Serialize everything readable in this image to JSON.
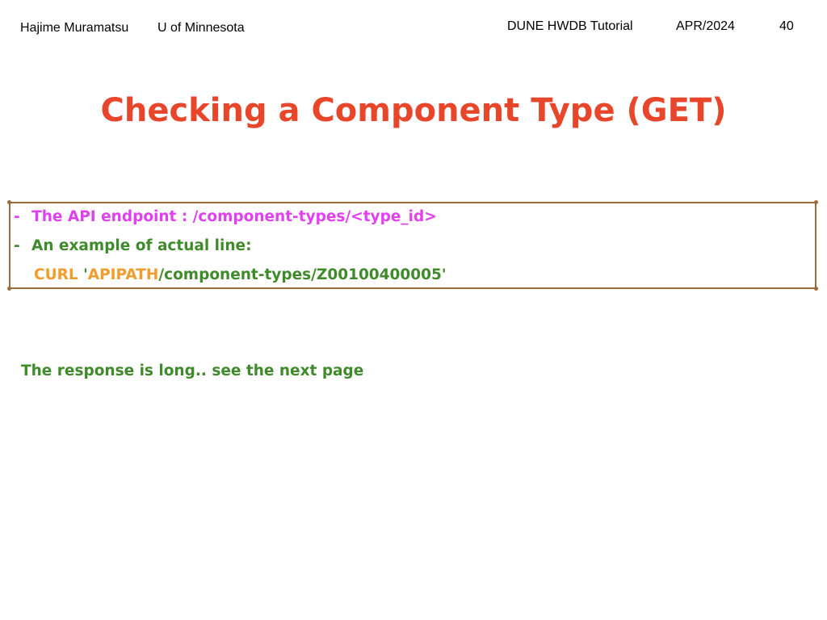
{
  "header": {
    "author": "Hajime Muramatsu",
    "institution": "U of Minnesota",
    "talk": "DUNE HWDB Tutorial",
    "date": "APR/2024",
    "page_number": "40"
  },
  "title": "Checking a Component Type (GET)",
  "box": {
    "line1_bullet": "-",
    "line1_text": "The API endpoint : /component-types/<type_id>",
    "line2_bullet": "-",
    "line2_text": "An example of actual line:",
    "line3_curl": "CURL",
    "line3_quote_open": "'",
    "line3_apipath": "APIPATH",
    "line3_rest": "/component-types/Z00100400005'"
  },
  "note": "The response is long.. see the next page",
  "colors": {
    "title": "#e8462b",
    "endpoint": "#e040f0",
    "example": "#3f8a2a",
    "highlight": "#f29c2b",
    "box_border": "#9c6b3c"
  }
}
